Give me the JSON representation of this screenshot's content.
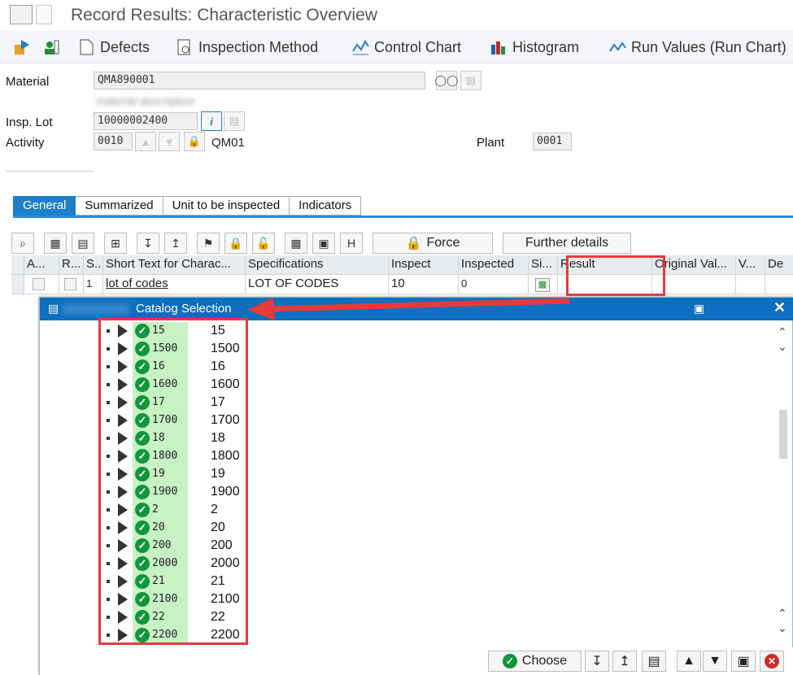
{
  "window": {
    "title": "Record Results: Characteristic Overview"
  },
  "toolbar": {
    "items": [
      {
        "label": "",
        "icon": "transfer-icon"
      },
      {
        "label": "",
        "icon": "person-icon"
      },
      {
        "label": "Defects",
        "icon": "document-icon"
      },
      {
        "label": "Inspection Method",
        "icon": "method-icon"
      },
      {
        "label": "Control Chart",
        "icon": "control-chart-icon"
      },
      {
        "label": "Histogram",
        "icon": "histogram-icon"
      },
      {
        "label": "Run Values (Run Chart)",
        "icon": "run-chart-icon"
      }
    ]
  },
  "header": {
    "material_label": "Material",
    "material_value": "QMA890001",
    "material_description": "material description",
    "insp_lot_label": "Insp. Lot",
    "insp_lot_value": "10000002400",
    "activity_label": "Activity",
    "activity_value": "0010",
    "activity_code": "QM01",
    "plant_label": "Plant",
    "plant_value": "0001"
  },
  "tabs": [
    "General",
    "Summarized",
    "Unit to be inspected",
    "Indicators"
  ],
  "table_buttons": {
    "force": "Force",
    "further_details": "Further details"
  },
  "grid": {
    "columns": [
      "A...",
      "R...",
      "S..",
      "Short Text for Charac...",
      "Specifications",
      "Inspect",
      "Inspected",
      "Si...",
      "Result",
      "Original Val...",
      "V...",
      "De"
    ],
    "row": {
      "s": "1",
      "short_text": "lot of codes",
      "spec": "LOT OF CODES",
      "inspect": "10",
      "inspected": "0",
      "result": ""
    }
  },
  "dialog": {
    "title": "Catalog Selection",
    "items": [
      {
        "code": "15",
        "text": "15"
      },
      {
        "code": "1500",
        "text": "1500"
      },
      {
        "code": "16",
        "text": "16"
      },
      {
        "code": "1600",
        "text": "1600"
      },
      {
        "code": "17",
        "text": "17"
      },
      {
        "code": "1700",
        "text": "1700"
      },
      {
        "code": "18",
        "text": "18"
      },
      {
        "code": "1800",
        "text": "1800"
      },
      {
        "code": "19",
        "text": "19"
      },
      {
        "code": "1900",
        "text": "1900"
      },
      {
        "code": "2",
        "text": "2"
      },
      {
        "code": "20",
        "text": "20"
      },
      {
        "code": "200",
        "text": "200"
      },
      {
        "code": "2000",
        "text": "2000"
      },
      {
        "code": "21",
        "text": "21"
      },
      {
        "code": "2100",
        "text": "2100"
      },
      {
        "code": "22",
        "text": "22"
      },
      {
        "code": "2200",
        "text": "2200"
      }
    ],
    "choose_label": "Choose"
  },
  "colors": {
    "accent": "#0d6fbf",
    "highlight": "#e53b3b",
    "green": "#11963a"
  }
}
